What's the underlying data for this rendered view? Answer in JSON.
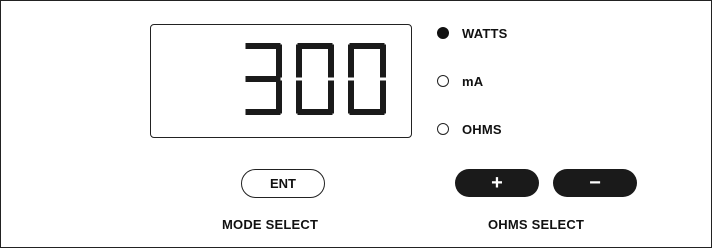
{
  "display": {
    "value": "300"
  },
  "modes": [
    {
      "label": "WATTS",
      "selected": true
    },
    {
      "label": "mA",
      "selected": false
    },
    {
      "label": "OHMS",
      "selected": false
    }
  ],
  "buttons": {
    "enter_label": "ENT",
    "plus_label": "+",
    "minus_label": "−"
  },
  "labels": {
    "mode_select": "MODE SELECT",
    "ohms_select": "OHMS SELECT"
  },
  "colors": {
    "ink": "#1a1a1a",
    "background": "#ffffff"
  }
}
